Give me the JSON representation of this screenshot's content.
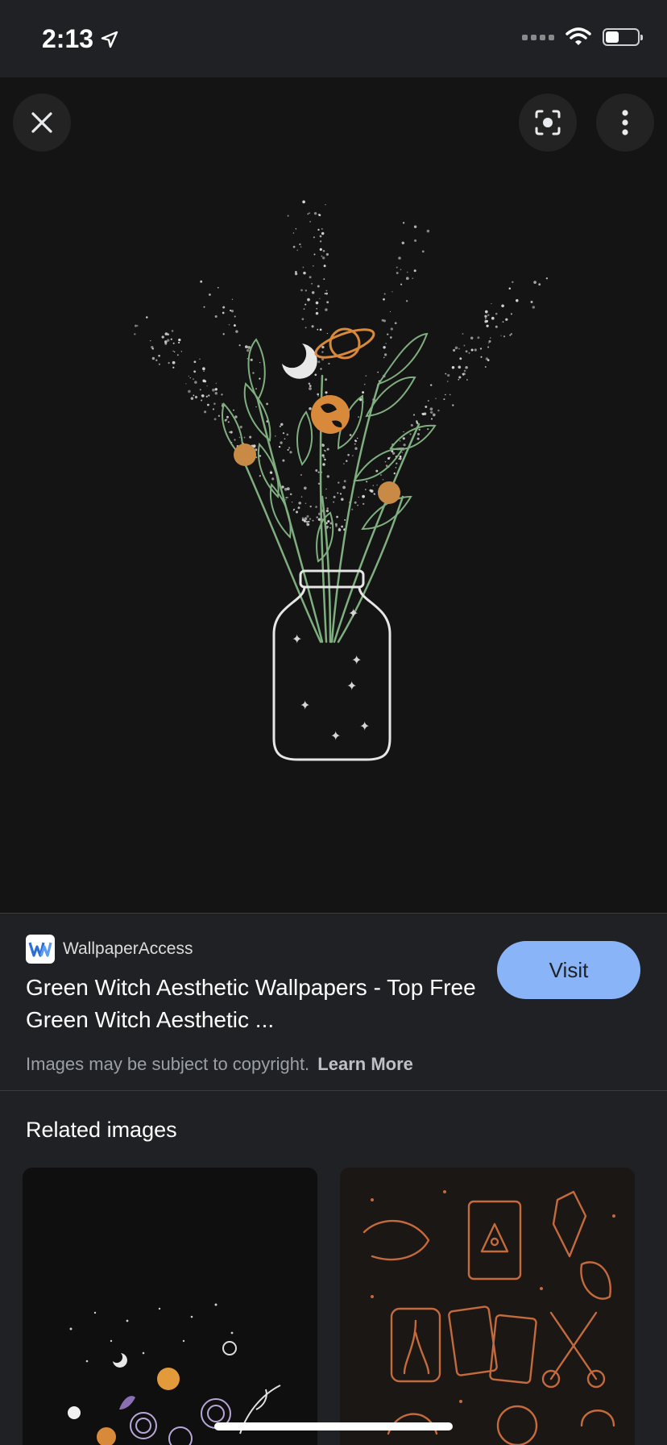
{
  "status_bar": {
    "time": "2:13",
    "icons": [
      "location-arrow-icon",
      "signal-icon",
      "wifi-icon",
      "battery-icon"
    ]
  },
  "toolbar": {
    "icons": [
      "close-icon",
      "lens-icon",
      "more-vertical-icon"
    ]
  },
  "result": {
    "source": "WallpaperAccess",
    "title": "Green Witch Aesthetic Wallpapers - Top Free Green Witch Aesthetic ...",
    "visit_label": "Visit",
    "copyright_text": "Images may be subject to copyright.",
    "learn_more": "Learn More"
  },
  "related": {
    "title": "Related images"
  },
  "colors": {
    "background": "#202124",
    "accent": "#8ab4f8",
    "leaf_green": "#7fae7f",
    "planet_orange": "#d8893a"
  }
}
